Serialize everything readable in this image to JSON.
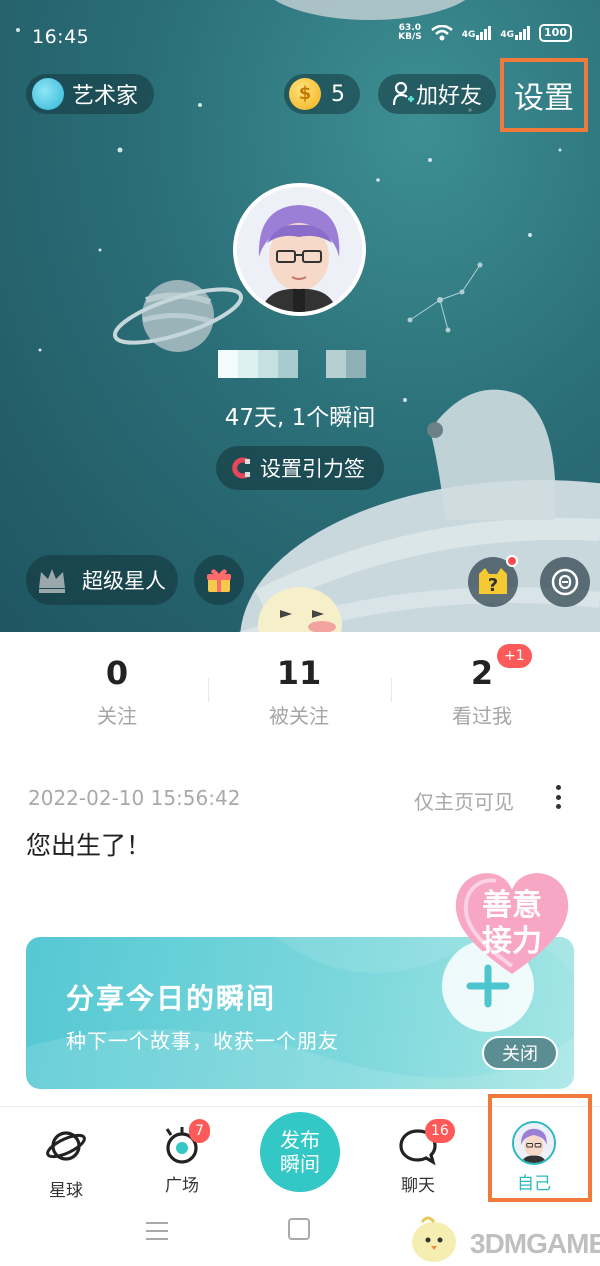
{
  "status_bar": {
    "time": "16:45",
    "net_speed_value": "63.0",
    "net_speed_unit": "KB/S",
    "signal1": "4G",
    "signal2": "4G",
    "battery": "100"
  },
  "header": {
    "artist_label": "艺术家",
    "coins": "5",
    "add_friend_label": "加好友",
    "settings_label": "设置"
  },
  "profile": {
    "days_moments": "47天, 1个瞬间",
    "gravity_label": "设置引力签",
    "superstar_label": "超级星人"
  },
  "stats": {
    "following_count": "0",
    "following_label": "关注",
    "followers_count": "11",
    "followers_label": "被关注",
    "viewed_count": "2",
    "viewed_label": "看过我",
    "viewed_badge": "+1"
  },
  "moment": {
    "timestamp": "2022-02-10 15:56:42",
    "visibility": "仅主页可见",
    "text": "您出生了！"
  },
  "share_banner": {
    "title": "分享今日的瞬间",
    "subtitle": "种下一个故事，收获一个朋友",
    "kindness_line1": "善意",
    "kindness_line2": "接力",
    "close_label": "关闭"
  },
  "bottom_nav": {
    "planet_label": "星球",
    "square_label": "广场",
    "square_badge": "7",
    "post_line1": "发布",
    "post_line2": "瞬间",
    "chat_label": "聊天",
    "chat_badge": "16",
    "me_label": "自己"
  },
  "watermark": "3DMGAME",
  "colors": {
    "accent": "#33c7c6",
    "hero_bg": "#2b6f78",
    "highlight_box": "#f07a3c",
    "badge": "#ff5a5a"
  },
  "icons": [
    "planet-icon",
    "square-eye-icon",
    "chat-icon",
    "gift-icon",
    "crown-icon",
    "magnet-icon",
    "coin-icon",
    "add-friend-icon",
    "more-icon",
    "mystery-box-icon",
    "voice-icon"
  ]
}
